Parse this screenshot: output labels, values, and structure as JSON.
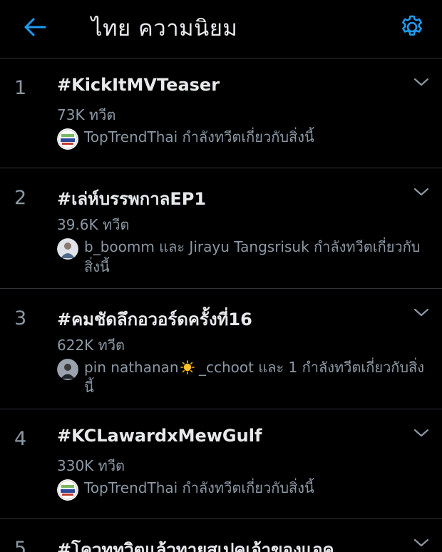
{
  "header": {
    "title": "ไทย ความนิยม",
    "back_icon": "arrow-left-icon",
    "settings_icon": "gear-icon",
    "accent_color": "#1d9bf0"
  },
  "trends": [
    {
      "rank": "1",
      "tag": "#KickItMVTeaser",
      "count": "73K ทวีต",
      "context": "TopTrendThai กำลังทวีตเกี่ยวกับสิ่งนี้",
      "avatar": "toptrendthai-avatar"
    },
    {
      "rank": "2",
      "tag": "#เล่ห์บรรพกาลEP1",
      "count": "39.6K ทวีต",
      "context": "b_boomm และ Jirayu Tangsrisuk กำลังทวีตเกี่ยวกับสิ่งนี้",
      "avatar": "user-avatar"
    },
    {
      "rank": "3",
      "tag": "#คมชัดลึกอวอร์ดครั้งที่16",
      "count": "622K ทวีต",
      "context_before_emoji": "pin nathanan",
      "context_after_emoji": " _cchoot และ 1 กำลังทวีตเกี่ยวกับสิ่งนี้",
      "avatar": "user-avatar"
    },
    {
      "rank": "4",
      "tag": "#KCLawardxMewGulf",
      "count": "330K ทวีต",
      "context": "TopTrendThai กำลังทวีตเกี่ยวกับสิ่งนี้",
      "avatar": "toptrendthai-avatar"
    },
    {
      "rank": "5",
      "tag": "#โควททวิตแล้วทายสเปคเจ้าของแอค"
    }
  ]
}
